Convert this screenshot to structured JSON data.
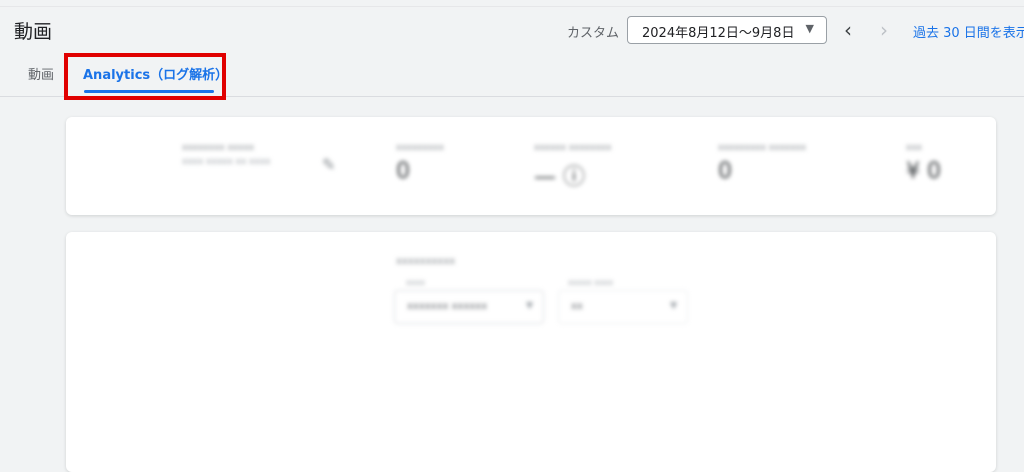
{
  "header": {
    "title": "動画",
    "custom_label": "カスタム",
    "date_range": "2024年8月12日～9月8日",
    "prev_icon": "chevron-left-icon",
    "next_icon": "chevron-right-icon",
    "show_past_link": "過去 30 日間を表示"
  },
  "tabs": [
    {
      "label": "動画",
      "active": false
    },
    {
      "label": "Analytics（ログ解析）",
      "active": true
    }
  ],
  "colors": {
    "accent": "#1a73e8",
    "highlight_box": "#e00000",
    "background": "#f1f3f4"
  },
  "stats_card": {
    "video_title": "xxxxxxxx xxxxx",
    "video_subtitle": "xxxx xxxxx xx xxxx",
    "edit_icon": "pencil-icon",
    "metrics": [
      {
        "label": "xxxxxxxxx",
        "value": "0"
      },
      {
        "label": "xxxxxx xxxxxxxx",
        "value": "— ⓘ"
      },
      {
        "label": "xxxxxxxxx xxxxxxx",
        "value": "0"
      },
      {
        "label": "xxx",
        "value": "¥ 0"
      }
    ]
  },
  "filters": {
    "title": "xxxxxxxxxx",
    "select1_label": "xxxx",
    "select1_value": "xxxxxxx xxxxxx",
    "select2_label": "xxxxx xxxx",
    "select2_value": "xx"
  }
}
